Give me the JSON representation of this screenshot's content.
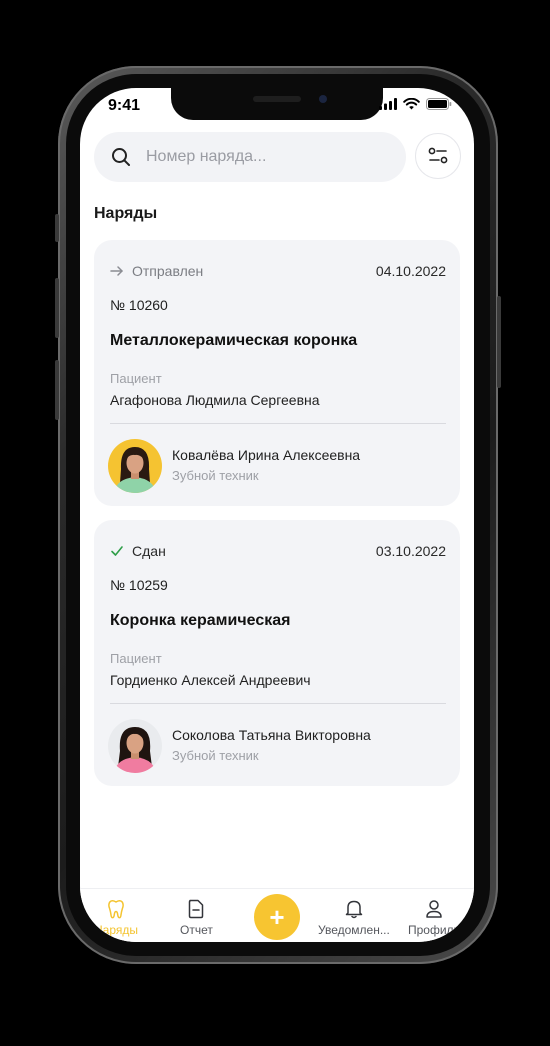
{
  "status_bar": {
    "time": "9:41"
  },
  "search": {
    "placeholder": "Номер наряда..."
  },
  "section_title": "Наряды",
  "orders": [
    {
      "status": "Отправлен",
      "status_icon": "arrow-right-icon",
      "date": "04.10.2022",
      "number": "№ 10260",
      "title": "Металлокерамическая коронка",
      "patient_label": "Пациент",
      "patient_name": "Агафонова Людмила Сергеевна",
      "technician_name": "Ковалёва Ирина Алексеевна",
      "technician_role": "Зубной техник",
      "avatar_bg": "#f5c331"
    },
    {
      "status": "Сдан",
      "status_icon": "check-icon",
      "date": "03.10.2022",
      "number": "№ 10259",
      "title": "Коронка керамическая",
      "patient_label": "Пациент",
      "patient_name": "Гордиенко Алексей Андреевич",
      "technician_name": "Соколова Татьяна Викторовна",
      "technician_role": "Зубной техник",
      "avatar_bg": "#e9ebee"
    }
  ],
  "nav": {
    "orders": "Наряды",
    "report": "Отчет",
    "add": "+",
    "notifications": "Уведомлен...",
    "profile": "Профиль"
  },
  "colors": {
    "accent": "#f7c531",
    "success": "#2e9e48",
    "card_bg": "#f3f4f7"
  }
}
